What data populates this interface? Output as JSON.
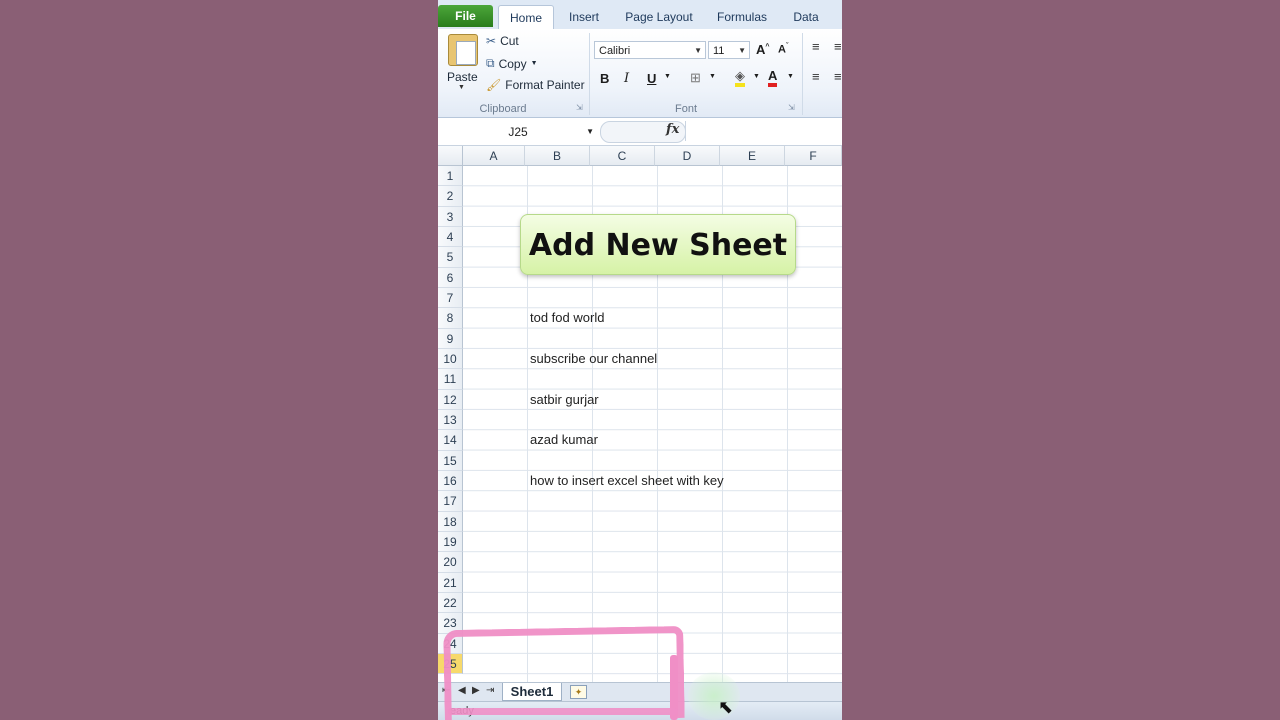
{
  "ribbon": {
    "tabs": [
      "File",
      "Home",
      "Insert",
      "Page Layout",
      "Formulas",
      "Data"
    ],
    "clipboard": {
      "paste": "Paste",
      "cut": "Cut",
      "copy": "Copy",
      "format_painter": "Format Painter",
      "label": "Clipboard"
    },
    "font": {
      "name": "Calibri",
      "size": "11",
      "bold": "B",
      "italic": "I",
      "underline": "U",
      "label": "Font"
    }
  },
  "formula_bar": {
    "name_box": "J25",
    "fx": "fx",
    "value": ""
  },
  "grid": {
    "columns": [
      "A",
      "B",
      "C",
      "D",
      "E",
      "F"
    ],
    "rows": [
      "1",
      "2",
      "3",
      "4",
      "5",
      "6",
      "7",
      "8",
      "9",
      "10",
      "11",
      "12",
      "13",
      "14",
      "15",
      "16",
      "17",
      "18",
      "19",
      "20",
      "21",
      "22",
      "23",
      "24",
      "25"
    ],
    "cells": [
      {
        "row": "8",
        "text": "tod fod world"
      },
      {
        "row": "10",
        "text": "subscribe our channel"
      },
      {
        "row": "12",
        "text": "satbir gurjar"
      },
      {
        "row": "14",
        "text": "azad kumar"
      },
      {
        "row": "16",
        "text": "how to insert excel sheet with key"
      }
    ]
  },
  "overlay": {
    "title": "Add New Sheet"
  },
  "sheets": {
    "tabs": [
      "Sheet1"
    ]
  },
  "status": {
    "text": "eady"
  },
  "colors": {
    "banner": "#d6f2a6",
    "highlight": "#f08fc6",
    "file_tab": "#2a7d1d"
  }
}
